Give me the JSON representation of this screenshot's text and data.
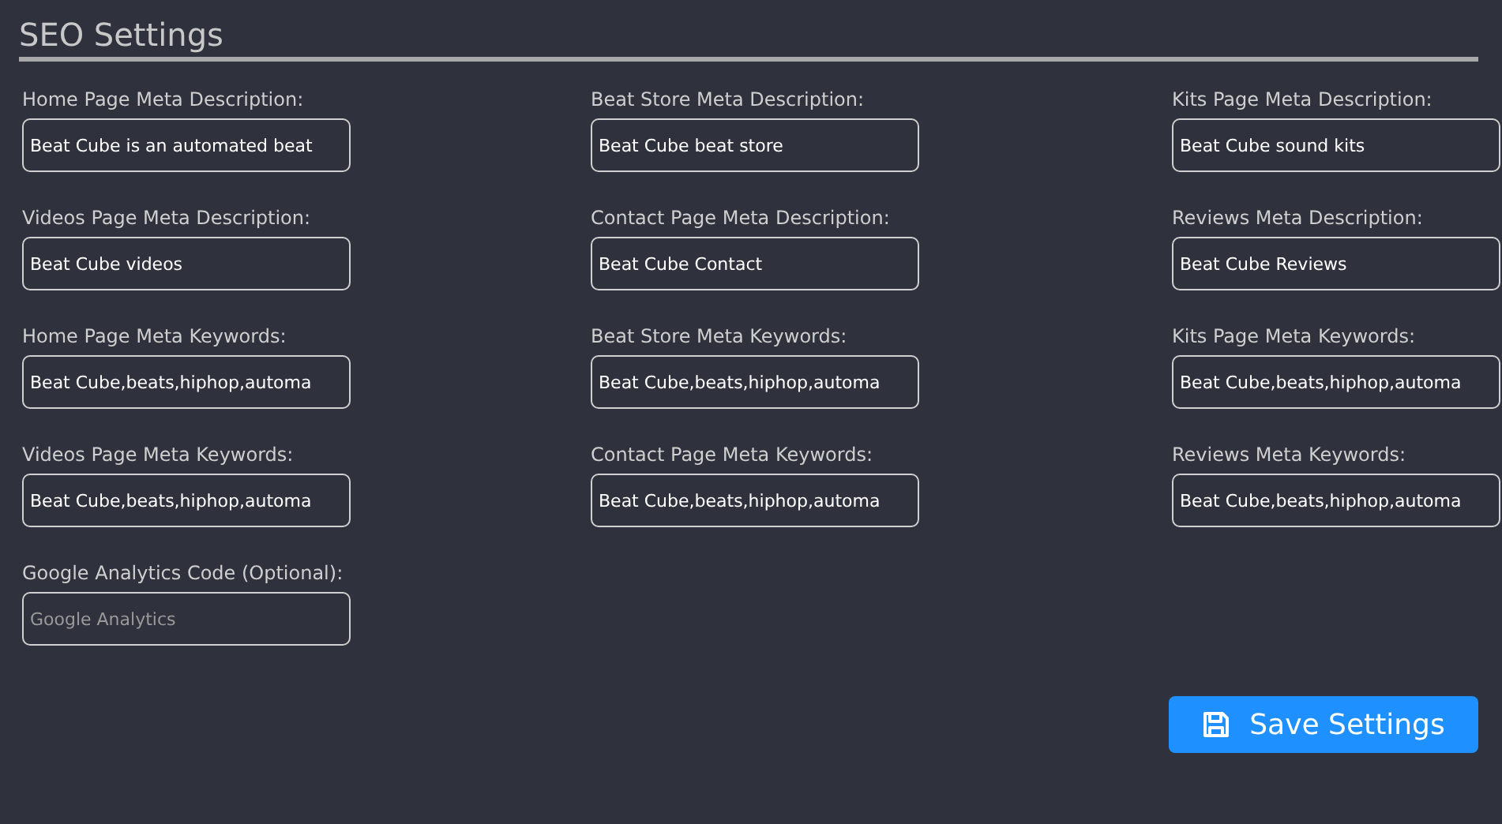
{
  "title": "SEO Settings",
  "fields": [
    {
      "label": "Home Page Meta Description:",
      "value": "Beat Cube is an automated beat"
    },
    {
      "label": "Beat Store Meta Description:",
      "value": "Beat Cube beat store"
    },
    {
      "label": "Kits Page Meta Description:",
      "value": "Beat Cube sound kits"
    },
    {
      "label": "Videos Page Meta Description:",
      "value": "Beat Cube videos"
    },
    {
      "label": "Contact Page Meta Description:",
      "value": "Beat Cube Contact"
    },
    {
      "label": "Reviews Meta Description:",
      "value": "Beat Cube Reviews"
    },
    {
      "label": "Home Page Meta Keywords:",
      "value": "Beat Cube,beats,hiphop,automa"
    },
    {
      "label": "Beat Store Meta Keywords:",
      "value": "Beat Cube,beats,hiphop,automa"
    },
    {
      "label": "Kits Page Meta Keywords:",
      "value": "Beat Cube,beats,hiphop,automa"
    },
    {
      "label": "Videos Page Meta Keywords:",
      "value": "Beat Cube,beats,hiphop,automa"
    },
    {
      "label": "Contact Page Meta Keywords:",
      "value": "Beat Cube,beats,hiphop,automa"
    },
    {
      "label": "Reviews Meta Keywords:",
      "value": "Beat Cube,beats,hiphop,automa"
    },
    {
      "label": "Google Analytics Code (Optional):",
      "placeholder": "Google Analytics"
    }
  ],
  "save_button": "Save Settings"
}
